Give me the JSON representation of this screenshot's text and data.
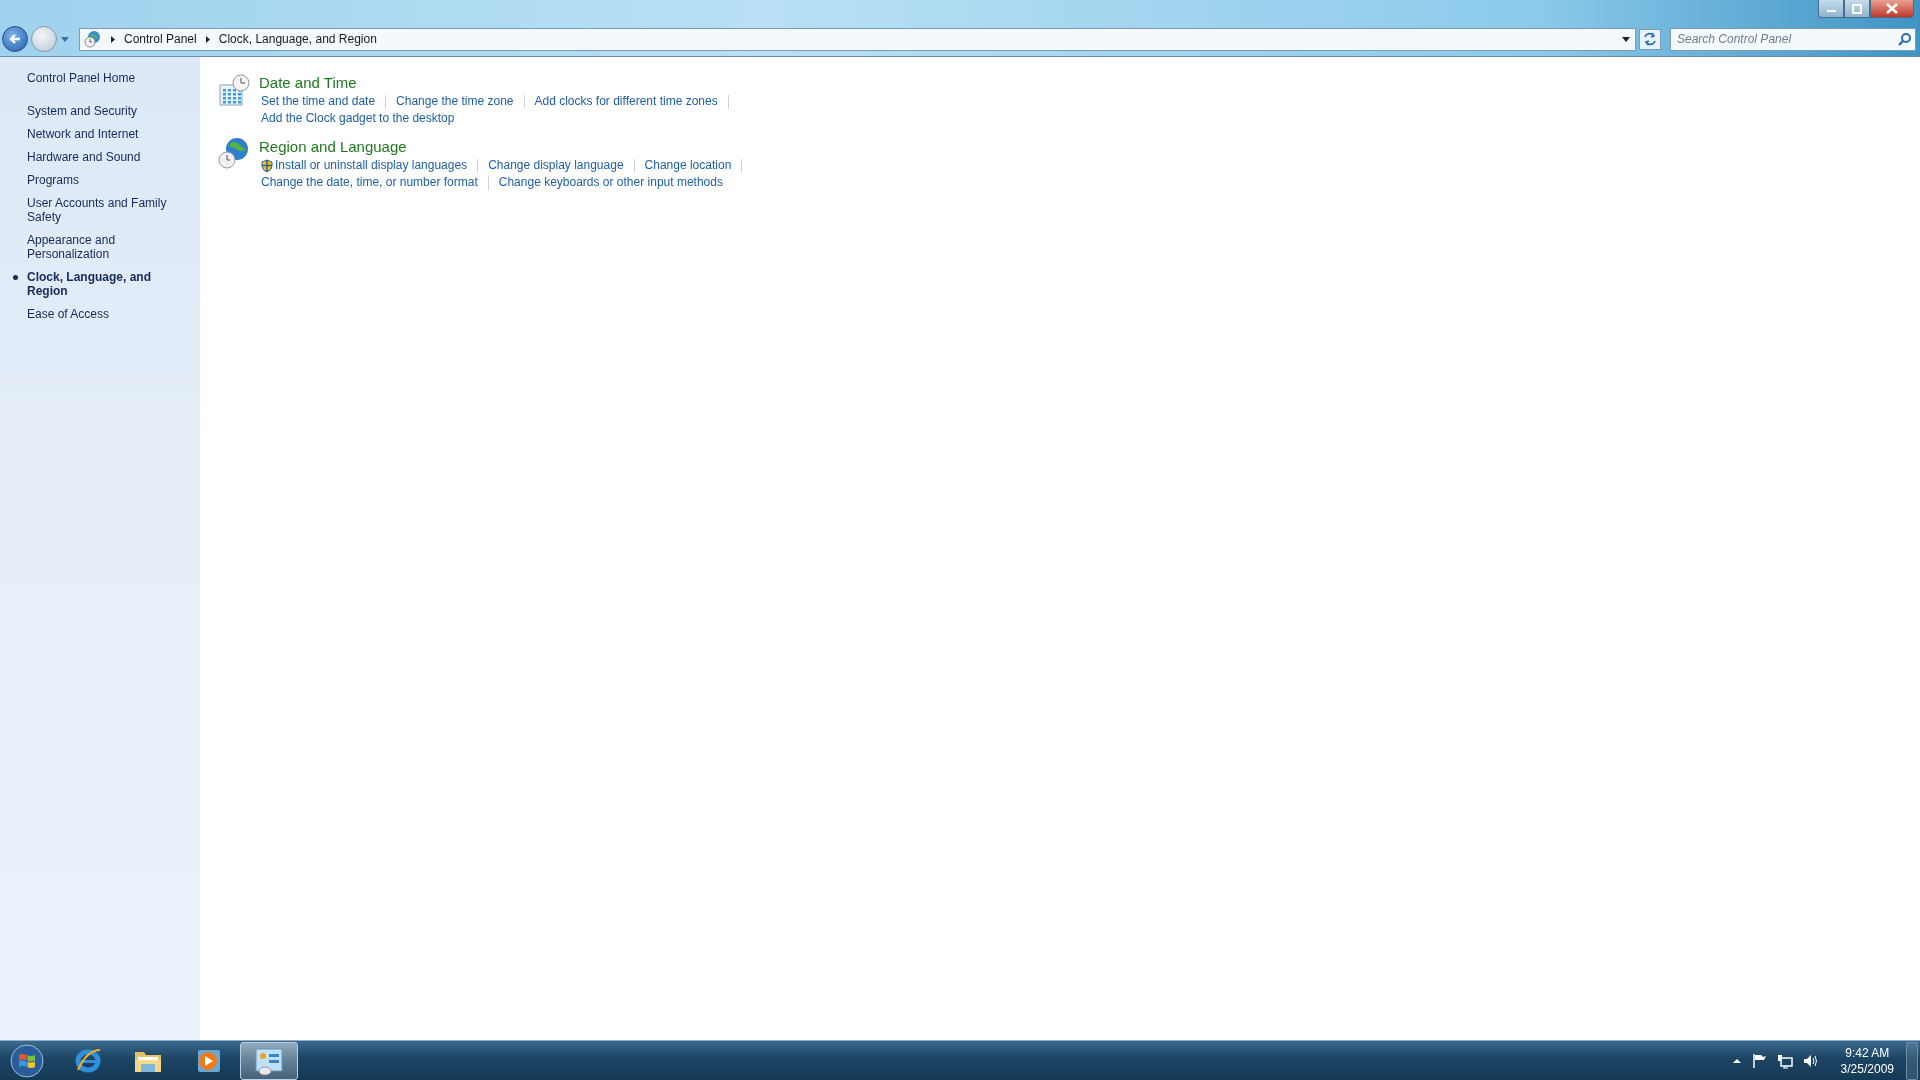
{
  "navigation": {
    "breadcrumb": [
      "Control Panel",
      "Clock, Language, and Region"
    ],
    "search": {
      "placeholder": "Search Control Panel"
    }
  },
  "sidebar": {
    "home": "Control Panel Home",
    "items": [
      {
        "label": "System and Security",
        "selected": false
      },
      {
        "label": "Network and Internet",
        "selected": false
      },
      {
        "label": "Hardware and Sound",
        "selected": false
      },
      {
        "label": "Programs",
        "selected": false
      },
      {
        "label": "User Accounts and Family Safety",
        "selected": false
      },
      {
        "label": "Appearance and Personalization",
        "selected": false
      },
      {
        "label": "Clock, Language, and Region",
        "selected": true
      },
      {
        "label": "Ease of Access",
        "selected": false
      }
    ]
  },
  "categories": [
    {
      "kind": "clock",
      "title": "Date and Time",
      "lines": [
        [
          {
            "label": "Set the time and date",
            "shield": false
          },
          {
            "label": "Change the time zone",
            "shield": false
          },
          {
            "label": "Add clocks for different time zones",
            "shield": false
          }
        ],
        [
          {
            "label": "Add the Clock gadget to the desktop",
            "shield": false
          }
        ]
      ]
    },
    {
      "kind": "globe",
      "title": "Region and Language",
      "lines": [
        [
          {
            "label": "Install or uninstall display languages",
            "shield": true
          },
          {
            "label": "Change display language",
            "shield": false
          },
          {
            "label": "Change location",
            "shield": false
          }
        ],
        [
          {
            "label": "Change the date, time, or number format",
            "shield": false
          },
          {
            "label": "Change keyboards or other input methods",
            "shield": false
          }
        ]
      ]
    }
  ],
  "taskbar": {
    "apps": [
      {
        "kind": "browser",
        "active": false
      },
      {
        "kind": "folder",
        "active": false
      },
      {
        "kind": "media",
        "active": false
      },
      {
        "kind": "control-panel",
        "active": true
      }
    ],
    "clock": {
      "time": "9:42 AM",
      "date": "3/25/2009"
    }
  }
}
